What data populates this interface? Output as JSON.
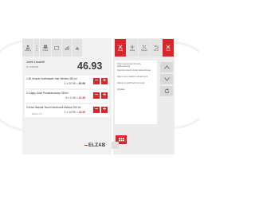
{
  "toolbar": {
    "buttons": [
      {
        "label": "Zaloguj",
        "icon": "login-icon",
        "color": "grey"
      },
      {
        "label": "",
        "icon": "vertical-dots-icon",
        "color": "grey"
      },
      {
        "label": "Drukuj",
        "icon": "print-icon",
        "color": "grey"
      },
      {
        "label": "",
        "icon": "card-icon",
        "color": "grey"
      },
      {
        "label": "",
        "icon": "chart-icon",
        "color": "grey"
      },
      {
        "label": "",
        "icon": "up-icon",
        "color": "grey"
      },
      {
        "label": "Anuluj",
        "icon": "close-icon",
        "color": "red"
      },
      {
        "label": "Dodaj",
        "icon": "add-icon",
        "color": "grey"
      },
      {
        "label": "Rabaty",
        "icon": "discount-icon",
        "color": "grey"
      },
      {
        "label": "Zwrot",
        "icon": "return-icon",
        "color": "grey"
      },
      {
        "label": "Usuń",
        "icon": "delete-icon",
        "color": "red"
      }
    ]
  },
  "customer": {
    "name": "Jurek Leczmiñ",
    "subtitle": "Nr 14580098"
  },
  "total": "46.93",
  "cart": {
    "items": [
      {
        "name": "1.Mr Muscle Kraftmaster Hair Whitent 350 ml",
        "qty": "1",
        "price": "20.99",
        "amount": "20.99",
        "amount_color": "dark",
        "note": ""
      },
      {
        "name": "2.Cappy Juice Pomarańczowy 330ml",
        "qty": "5",
        "price": "2.49",
        "amount": "12.45",
        "amount_color": "red",
        "note": ""
      },
      {
        "name": "3.Dove Natural Touch Deodorant Mineral 150 ml",
        "qty": "1",
        "price": "14.99",
        "amount": "13.49",
        "amount_color": "red",
        "note": "Rabat 1.5 zł"
      }
    ]
  },
  "messages": [
    "Klient niema jeszcze karty lojalnościowej",
    "Zaproponować 1 kartę lojalnościowa",
    "Klient ma w ostatnio zakupionych",
    "Zakupy w godzinach promocji",
    "Wypłata"
  ],
  "colors": {
    "accent": "#d9262b",
    "panel": "#f1f1f1",
    "text": "#3a3a3a"
  },
  "logo": {
    "text": "ELZAB"
  }
}
